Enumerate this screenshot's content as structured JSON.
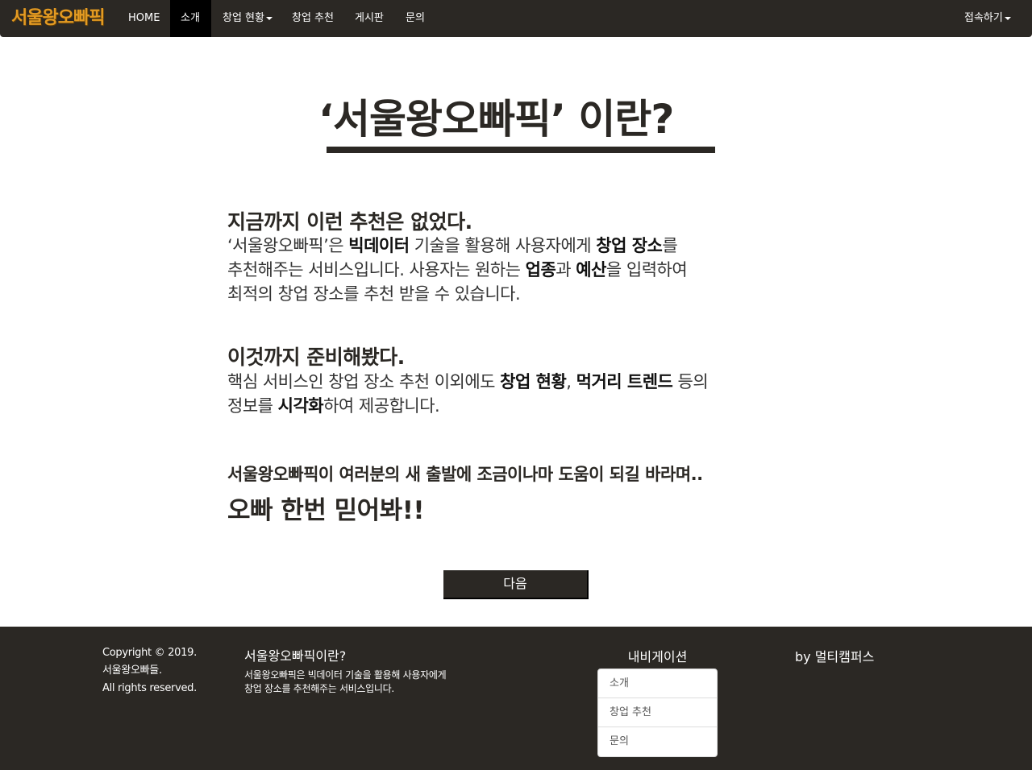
{
  "navbar": {
    "brand": "서울왕오빠픽",
    "items": [
      "HOME",
      "소개",
      "창업 현황",
      "창업 추천",
      "게시판",
      "문의"
    ],
    "active": "소개",
    "login": "접속하기"
  },
  "main": {
    "title": "‘서울왕오빠픽’ 이란?",
    "section1": {
      "heading": "지금까지 이런 추천은 없었다.",
      "line1_a": "‘서울왕오빠픽’은 ",
      "line1_b": "빅데이터",
      "line1_c": " 기술을 활용해 사용자에게 ",
      "line1_d": "창업 장소",
      "line1_e": "를",
      "line2_a": "추천해주는 서비스입니다. 사용자는 원하는 ",
      "line2_b": "업종",
      "line2_c": "과 ",
      "line2_d": "예산",
      "line2_e": "을 입력하여",
      "line3": "최적의 창업 장소를 추천 받을 수 있습니다."
    },
    "section2": {
      "heading": "이것까지 준비해봤다.",
      "line1_a": "핵심 서비스인 창업 장소 추천 이외에도 ",
      "line1_b": "창업 현황",
      "line1_c": ", ",
      "line1_d": "먹거리 트렌드",
      "line1_e": " 등의",
      "line2_a": "정보를 ",
      "line2_b": "시각화",
      "line2_c": "하여 제공합니다."
    },
    "closing": {
      "line1": "서울왕오빠픽이 여러분의 새 출발에 조금이나마 도움이 되길 바라며..",
      "line2": "오빠 한번 믿어봐!!"
    },
    "next_button": "다음"
  },
  "footer": {
    "copyright_lines": [
      "Copyright © 2019.",
      "서울왕오빠들.",
      "All rights reserved."
    ],
    "about_title": "서울왕오빠픽이란?",
    "about_lines": [
      "서울왕오빠픽은 빅데이터 기술을 활용해 사용자에게",
      "창업 장소를 추천해주는 서비스입니다."
    ],
    "nav_title": "내비게이션",
    "nav_items": [
      "소개",
      "창업 추천",
      "문의"
    ],
    "by": "by 멀티캠퍼스"
  }
}
